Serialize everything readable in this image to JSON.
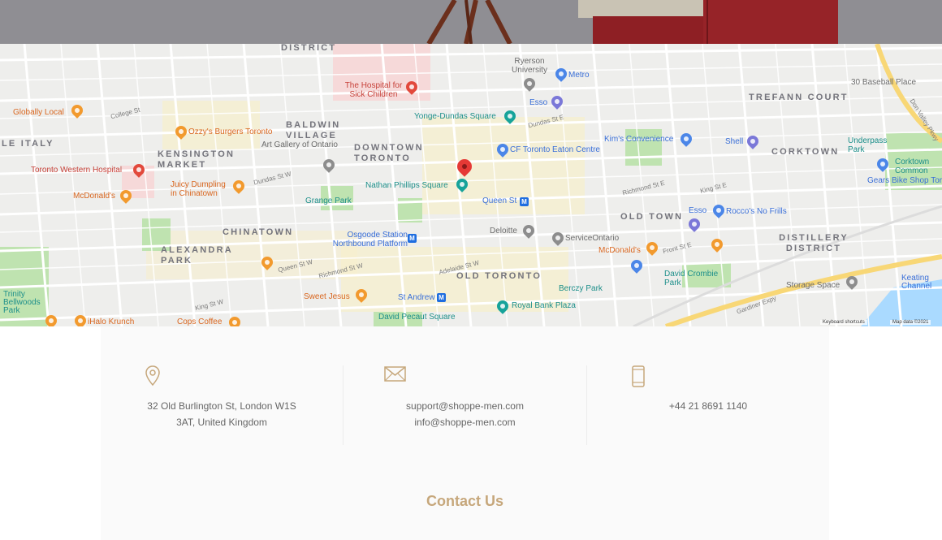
{
  "map": {
    "districts": [
      {
        "id": "district-top",
        "text": "DISTRICT"
      },
      {
        "id": "baldwin-village",
        "text": "BALDWIN VILLAGE"
      },
      {
        "id": "kensington-market",
        "text": "KENSINGTON MARKET"
      },
      {
        "id": "downtown-toronto",
        "text": "DOWNTOWN TORONTO"
      },
      {
        "id": "chinatown",
        "text": "CHINATOWN"
      },
      {
        "id": "alexandra-park",
        "text": "ALEXANDRA PARK"
      },
      {
        "id": "old-toronto",
        "text": "OLD TORONTO"
      },
      {
        "id": "old-town",
        "text": "OLD TOWN"
      },
      {
        "id": "trefann-court",
        "text": "TREFANN COURT"
      },
      {
        "id": "corktown",
        "text": "CORKTOWN"
      },
      {
        "id": "distillery-district",
        "text": "DISTILLERY DISTRICT"
      },
      {
        "id": "little-italy",
        "text": "LE ITALY"
      }
    ],
    "places": [
      {
        "text": "Globally Local"
      },
      {
        "text": "Ozzy's Burgers Toronto"
      },
      {
        "text": "Toronto Western Hospital"
      },
      {
        "text": "McDonald's"
      },
      {
        "text": "Juicy Dumpling in Chinatown"
      },
      {
        "text": "Art Gallery of Ontario"
      },
      {
        "text": "Grange Park"
      },
      {
        "text": "The Hospital for Sick Children"
      },
      {
        "text": "Yonge-Dundas Square"
      },
      {
        "text": "Ryerson University"
      },
      {
        "text": "Metro"
      },
      {
        "text": "Esso"
      },
      {
        "text": "CF Toronto Eaton Centre"
      },
      {
        "text": "Kim's Convenience"
      },
      {
        "text": "Shell"
      },
      {
        "text": "Nathan Phillips Square"
      },
      {
        "text": "Queen St"
      },
      {
        "text": "Osgoode Station Northbound Platform"
      },
      {
        "text": "Deloitte"
      },
      {
        "text": "ServiceOntario"
      },
      {
        "text": "McDonald's"
      },
      {
        "text": "Esso"
      },
      {
        "text": "Rocco's No Frills"
      },
      {
        "text": "Sweet Jesus"
      },
      {
        "text": "St Andrew"
      },
      {
        "text": "Berczy Park"
      },
      {
        "text": "Royal Bank Plaza"
      },
      {
        "text": "David Pecaut Square"
      },
      {
        "text": "David Crombie Park"
      },
      {
        "text": "Storage Space"
      },
      {
        "text": "Underpass Park"
      },
      {
        "text": "Corktown Common"
      },
      {
        "text": "Gears Bike Shop Toronto"
      },
      {
        "text": "30 Baseball Place"
      },
      {
        "text": "iHalo Krunch"
      },
      {
        "text": "Cops Coffee"
      },
      {
        "text": "Trinity Bellwoods Park"
      },
      {
        "text": "Keating Channel"
      }
    ],
    "streets": [
      {
        "text": "College St"
      },
      {
        "text": "Dundas St W"
      },
      {
        "text": "Queen St W"
      },
      {
        "text": "Richmond St W"
      },
      {
        "text": "Adelaide St W"
      },
      {
        "text": "King St W"
      },
      {
        "text": "Dundas St E"
      },
      {
        "text": "Richmond St E"
      },
      {
        "text": "King St E"
      },
      {
        "text": "Front St E"
      },
      {
        "text": "Gardiner Expy"
      },
      {
        "text": "Don Valley Pkwy"
      }
    ],
    "footer": {
      "shortcuts": "Keyboard shortcuts",
      "map_data": "Map data ©2021"
    }
  },
  "contact": {
    "address": {
      "icon": "location-pin-icon",
      "lines": [
        "32 Old Burlington St, London W1S",
        "3AT, United Kingdom"
      ]
    },
    "email": {
      "icon": "envelope-icon",
      "lines": [
        "support@shoppe-men.com",
        "info@shoppe-men.com"
      ]
    },
    "phone": {
      "icon": "mobile-phone-icon",
      "lines": [
        "+44 21 8691 1140"
      ]
    },
    "title": "Contact Us",
    "accent_color": "#c6a77b"
  }
}
